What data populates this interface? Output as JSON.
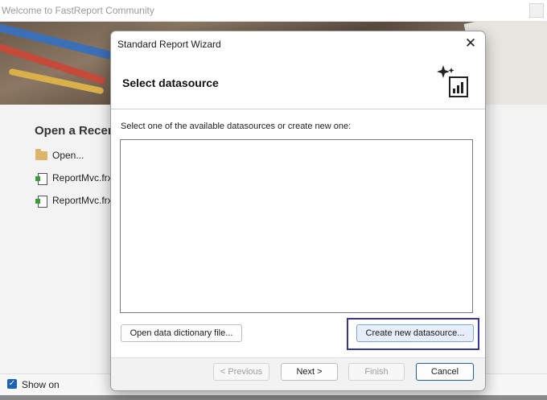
{
  "background_window": {
    "title": "Welcome to FastReport Community",
    "recent_heading": "Open a Recen",
    "recent_items": [
      "Open...",
      "ReportMvc.frx",
      "ReportMvc.frx"
    ],
    "show_on_label": "Show on",
    "show_on_checked": true
  },
  "dialog": {
    "title": "Standard Report Wizard",
    "close_glyph": "✕",
    "step_title": "Select datasource",
    "prompt": "Select one of the available datasources or create new one:",
    "datasources": [],
    "open_dictionary_label": "Open data dictionary file...",
    "create_datasource_label": "Create new datasource...",
    "buttons": {
      "previous": "< Previous",
      "next": "Next >",
      "finish": "Finish",
      "cancel": "Cancel"
    },
    "icon": "wizard-report-icon"
  },
  "colors": {
    "accent": "#1c62b9",
    "focus_outline": "#3636a6"
  }
}
